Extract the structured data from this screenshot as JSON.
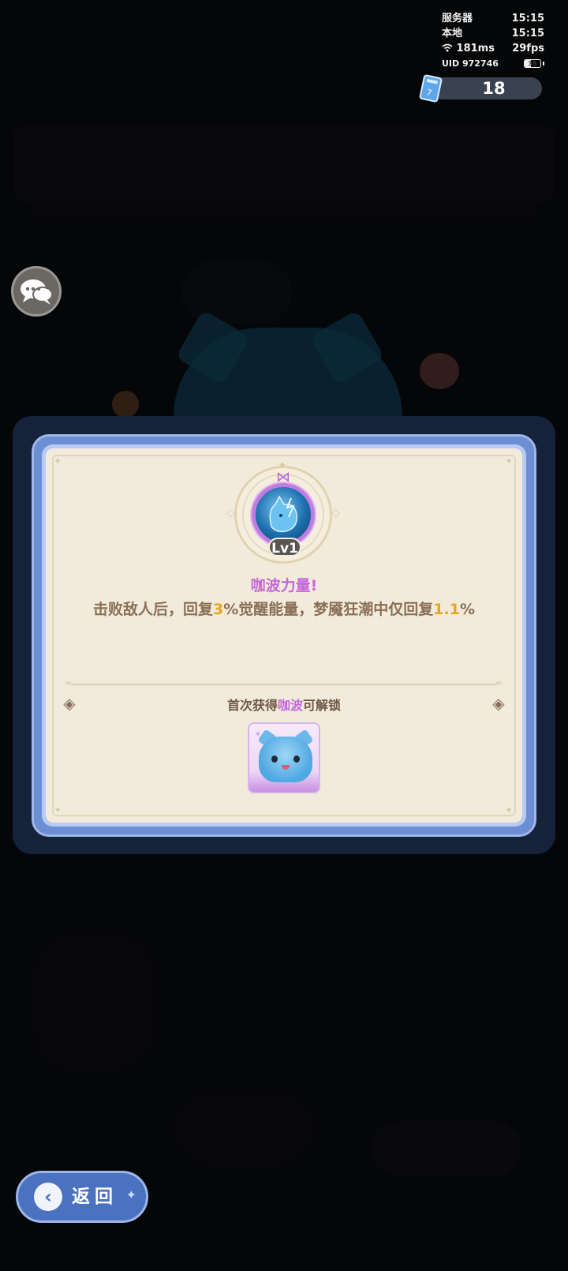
{
  "hud": {
    "server_label": "服务器",
    "server_time": "15:15",
    "local_label": "本地",
    "local_time": "15:15",
    "ping": "181ms",
    "fps": "29fps",
    "uid_label": "UID",
    "uid_value": "972746",
    "battery": "38"
  },
  "ticket": {
    "count": "18",
    "icon": "ticket-icon"
  },
  "chat": {
    "icon": "chat-bubbles-icon"
  },
  "modal": {
    "level": "Lv1",
    "skill_title": "咖波力量!",
    "desc_part1": "击败敌人后，回复",
    "desc_value1": "3",
    "desc_part2": "%觉醒能量，梦魇狂潮中仅回复",
    "desc_value2": "1.1",
    "desc_part3": "%",
    "unlock_prefix": "首次获得",
    "unlock_name": "咖波",
    "unlock_suffix": "可解锁"
  },
  "back_button": {
    "label": "返回"
  },
  "colors": {
    "accent_pink": "#c567dc",
    "highlight_orange": "#e8a51f",
    "frame_blue": "#6c8fd4",
    "paper": "#f2ebdc"
  }
}
